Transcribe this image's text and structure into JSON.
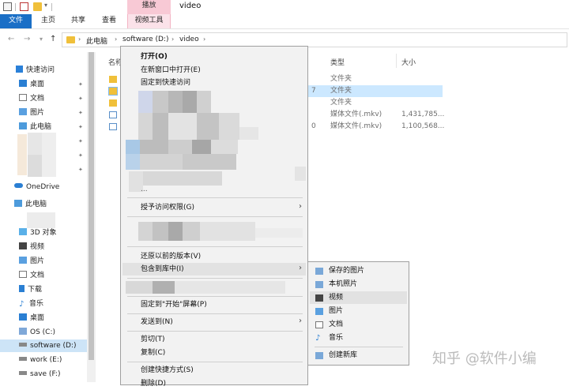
{
  "window": {
    "title": "video",
    "context_tab_group": "播放"
  },
  "ribbon": {
    "tabs": [
      "文件",
      "主页",
      "共享",
      "查看",
      "视频工具"
    ]
  },
  "address": {
    "crumbs": [
      "此电脑",
      "software (D:)",
      "video"
    ]
  },
  "nav": {
    "quick_access": "快速访问",
    "quick_items": [
      "桌面",
      "文档",
      "图片",
      "此电脑"
    ],
    "onedrive": "OneDrive",
    "this_pc": "此电脑",
    "pc_items": [
      "3D 对象",
      "视频",
      "图片",
      "文档",
      "下载",
      "音乐",
      "桌面",
      "OS (C:)",
      "software (D:)",
      "work (E:)",
      "save (F:)"
    ]
  },
  "files": {
    "columns": {
      "name_partial": "名称",
      "type": "类型",
      "size": "大小"
    },
    "rows": [
      {
        "date_partial": "",
        "type": "文件夹",
        "size": ""
      },
      {
        "date_partial": "7",
        "type": "文件夹",
        "size": ""
      },
      {
        "date_partial": "",
        "type": "文件夹",
        "size": ""
      },
      {
        "date_partial": "",
        "type": "媒体文件(.mkv)",
        "size": "1,431,785..."
      },
      {
        "date_partial": "0",
        "type": "媒体文件(.mkv)",
        "size": "1,100,568..."
      }
    ]
  },
  "context_menu": {
    "open": "打开(O)",
    "open_new_window": "在新窗口中打开(E)",
    "pin_quick_access": "固定到快速访问",
    "partial_text": "...",
    "grant_access": "授予访问权限(G)",
    "restore_versions": "还原以前的版本(V)",
    "include_in_library": "包含到库中(I)",
    "pin_start": "固定到\"开始\"屏幕(P)",
    "send_to": "发送到(N)",
    "cut": "剪切(T)",
    "copy": "复制(C)",
    "create_shortcut": "创建快捷方式(S)",
    "delete_partial": "删除(D)"
  },
  "submenu": {
    "items": [
      "保存的图片",
      "本机照片",
      "视频",
      "图片",
      "文档",
      "音乐"
    ],
    "new_library": "创建新库"
  },
  "watermark": "知乎 @软件小编",
  "colors": {
    "accent": "#1a6fc6",
    "context_tab": "#f8c9d5",
    "selection": "#cce8ff",
    "menu_bg": "#f2f2f2"
  }
}
